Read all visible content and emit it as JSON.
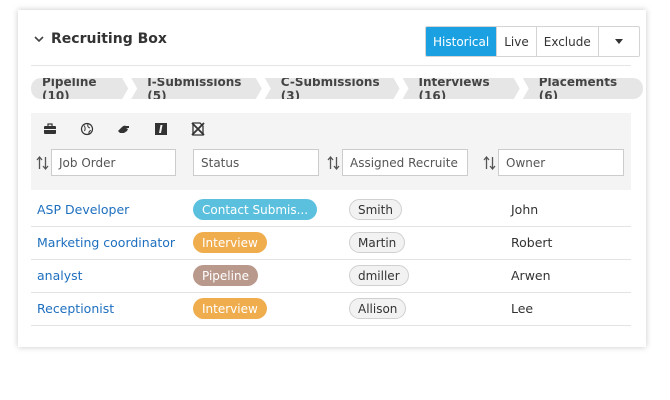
{
  "widget": {
    "title": "Recruiting Box"
  },
  "view_toggle": {
    "options": [
      "Historical",
      "Live",
      "Exclude"
    ],
    "active": "Historical",
    "accent": "#1ba1e2"
  },
  "tabs": [
    "Pipeline (10)",
    "I-Submissions (5)",
    "C-Submissions (3)",
    "Interviews (16)",
    "Placements (6)"
  ],
  "toolbar_icons": [
    "briefcase-icon",
    "globe-icon",
    "hand-icon",
    "edit-icon",
    "no-edit-icon"
  ],
  "filters": {
    "job_order": "Job Order",
    "status": "Status",
    "assigned_recruiter": "Assigned Recruite",
    "owner": "Owner"
  },
  "rows": [
    {
      "job_order": "ASP Developer",
      "status": "Contact Submis...",
      "status_color": "#5bc0de",
      "recruiter": "Smith",
      "owner": "John"
    },
    {
      "job_order": "Marketing coordinator",
      "status": "Interview",
      "status_color": "#f0ad4e",
      "recruiter": "Martin",
      "owner": "Robert"
    },
    {
      "job_order": "analyst",
      "status": "Pipeline",
      "status_color": "#b9998c",
      "recruiter": "dmiller",
      "owner": "Arwen"
    },
    {
      "job_order": "Receptionist",
      "status": "Interview",
      "status_color": "#f0ad4e",
      "recruiter": "Allison",
      "owner": "Lee"
    }
  ]
}
